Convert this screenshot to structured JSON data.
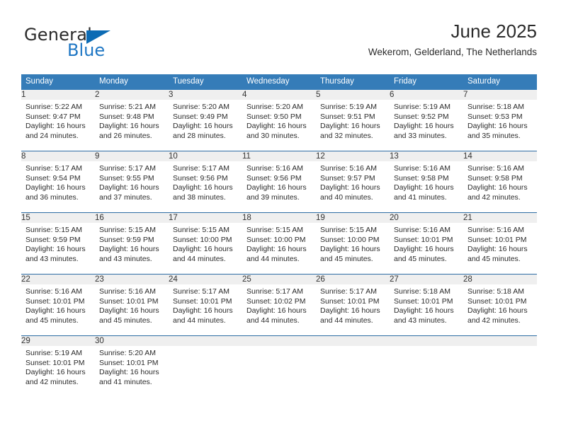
{
  "brand": {
    "name_top": "General",
    "name_bottom": "Blue",
    "accent_color": "#0c6bb4",
    "triangle_icon": "triangle-icon"
  },
  "header": {
    "title": "June 2025",
    "subtitle": "Wekerom, Gelderland, The Netherlands"
  },
  "calendar": {
    "header_bg": "#357cb8",
    "daynum_bg": "#efefef",
    "separator_color": "#2e6da4",
    "weekdays": [
      "Sunday",
      "Monday",
      "Tuesday",
      "Wednesday",
      "Thursday",
      "Friday",
      "Saturday"
    ],
    "weeks": [
      [
        {
          "day": "1",
          "sunrise": "Sunrise: 5:22 AM",
          "sunset": "Sunset: 9:47 PM",
          "daylight": "Daylight: 16 hours and 24 minutes."
        },
        {
          "day": "2",
          "sunrise": "Sunrise: 5:21 AM",
          "sunset": "Sunset: 9:48 PM",
          "daylight": "Daylight: 16 hours and 26 minutes."
        },
        {
          "day": "3",
          "sunrise": "Sunrise: 5:20 AM",
          "sunset": "Sunset: 9:49 PM",
          "daylight": "Daylight: 16 hours and 28 minutes."
        },
        {
          "day": "4",
          "sunrise": "Sunrise: 5:20 AM",
          "sunset": "Sunset: 9:50 PM",
          "daylight": "Daylight: 16 hours and 30 minutes."
        },
        {
          "day": "5",
          "sunrise": "Sunrise: 5:19 AM",
          "sunset": "Sunset: 9:51 PM",
          "daylight": "Daylight: 16 hours and 32 minutes."
        },
        {
          "day": "6",
          "sunrise": "Sunrise: 5:19 AM",
          "sunset": "Sunset: 9:52 PM",
          "daylight": "Daylight: 16 hours and 33 minutes."
        },
        {
          "day": "7",
          "sunrise": "Sunrise: 5:18 AM",
          "sunset": "Sunset: 9:53 PM",
          "daylight": "Daylight: 16 hours and 35 minutes."
        }
      ],
      [
        {
          "day": "8",
          "sunrise": "Sunrise: 5:17 AM",
          "sunset": "Sunset: 9:54 PM",
          "daylight": "Daylight: 16 hours and 36 minutes."
        },
        {
          "day": "9",
          "sunrise": "Sunrise: 5:17 AM",
          "sunset": "Sunset: 9:55 PM",
          "daylight": "Daylight: 16 hours and 37 minutes."
        },
        {
          "day": "10",
          "sunrise": "Sunrise: 5:17 AM",
          "sunset": "Sunset: 9:56 PM",
          "daylight": "Daylight: 16 hours and 38 minutes."
        },
        {
          "day": "11",
          "sunrise": "Sunrise: 5:16 AM",
          "sunset": "Sunset: 9:56 PM",
          "daylight": "Daylight: 16 hours and 39 minutes."
        },
        {
          "day": "12",
          "sunrise": "Sunrise: 5:16 AM",
          "sunset": "Sunset: 9:57 PM",
          "daylight": "Daylight: 16 hours and 40 minutes."
        },
        {
          "day": "13",
          "sunrise": "Sunrise: 5:16 AM",
          "sunset": "Sunset: 9:58 PM",
          "daylight": "Daylight: 16 hours and 41 minutes."
        },
        {
          "day": "14",
          "sunrise": "Sunrise: 5:16 AM",
          "sunset": "Sunset: 9:58 PM",
          "daylight": "Daylight: 16 hours and 42 minutes."
        }
      ],
      [
        {
          "day": "15",
          "sunrise": "Sunrise: 5:15 AM",
          "sunset": "Sunset: 9:59 PM",
          "daylight": "Daylight: 16 hours and 43 minutes."
        },
        {
          "day": "16",
          "sunrise": "Sunrise: 5:15 AM",
          "sunset": "Sunset: 9:59 PM",
          "daylight": "Daylight: 16 hours and 43 minutes."
        },
        {
          "day": "17",
          "sunrise": "Sunrise: 5:15 AM",
          "sunset": "Sunset: 10:00 PM",
          "daylight": "Daylight: 16 hours and 44 minutes."
        },
        {
          "day": "18",
          "sunrise": "Sunrise: 5:15 AM",
          "sunset": "Sunset: 10:00 PM",
          "daylight": "Daylight: 16 hours and 44 minutes."
        },
        {
          "day": "19",
          "sunrise": "Sunrise: 5:15 AM",
          "sunset": "Sunset: 10:00 PM",
          "daylight": "Daylight: 16 hours and 45 minutes."
        },
        {
          "day": "20",
          "sunrise": "Sunrise: 5:16 AM",
          "sunset": "Sunset: 10:01 PM",
          "daylight": "Daylight: 16 hours and 45 minutes."
        },
        {
          "day": "21",
          "sunrise": "Sunrise: 5:16 AM",
          "sunset": "Sunset: 10:01 PM",
          "daylight": "Daylight: 16 hours and 45 minutes."
        }
      ],
      [
        {
          "day": "22",
          "sunrise": "Sunrise: 5:16 AM",
          "sunset": "Sunset: 10:01 PM",
          "daylight": "Daylight: 16 hours and 45 minutes."
        },
        {
          "day": "23",
          "sunrise": "Sunrise: 5:16 AM",
          "sunset": "Sunset: 10:01 PM",
          "daylight": "Daylight: 16 hours and 45 minutes."
        },
        {
          "day": "24",
          "sunrise": "Sunrise: 5:17 AM",
          "sunset": "Sunset: 10:01 PM",
          "daylight": "Daylight: 16 hours and 44 minutes."
        },
        {
          "day": "25",
          "sunrise": "Sunrise: 5:17 AM",
          "sunset": "Sunset: 10:02 PM",
          "daylight": "Daylight: 16 hours and 44 minutes."
        },
        {
          "day": "26",
          "sunrise": "Sunrise: 5:17 AM",
          "sunset": "Sunset: 10:01 PM",
          "daylight": "Daylight: 16 hours and 44 minutes."
        },
        {
          "day": "27",
          "sunrise": "Sunrise: 5:18 AM",
          "sunset": "Sunset: 10:01 PM",
          "daylight": "Daylight: 16 hours and 43 minutes."
        },
        {
          "day": "28",
          "sunrise": "Sunrise: 5:18 AM",
          "sunset": "Sunset: 10:01 PM",
          "daylight": "Daylight: 16 hours and 42 minutes."
        }
      ],
      [
        {
          "day": "29",
          "sunrise": "Sunrise: 5:19 AM",
          "sunset": "Sunset: 10:01 PM",
          "daylight": "Daylight: 16 hours and 42 minutes."
        },
        {
          "day": "30",
          "sunrise": "Sunrise: 5:20 AM",
          "sunset": "Sunset: 10:01 PM",
          "daylight": "Daylight: 16 hours and 41 minutes."
        },
        {
          "day": "",
          "sunrise": "",
          "sunset": "",
          "daylight": ""
        },
        {
          "day": "",
          "sunrise": "",
          "sunset": "",
          "daylight": ""
        },
        {
          "day": "",
          "sunrise": "",
          "sunset": "",
          "daylight": ""
        },
        {
          "day": "",
          "sunrise": "",
          "sunset": "",
          "daylight": ""
        },
        {
          "day": "",
          "sunrise": "",
          "sunset": "",
          "daylight": ""
        }
      ]
    ]
  }
}
